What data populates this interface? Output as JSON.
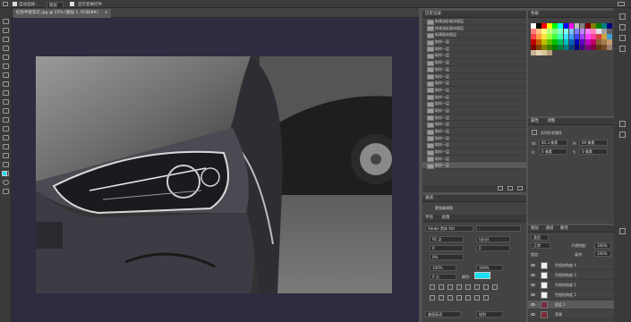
{
  "options_bar": {
    "auto_select_label": "自动选择：",
    "auto_select_value": "图层",
    "show_transform_label": "显示变换控件"
  },
  "document_tab": {
    "title": "红色半瓷车灯.jpg @ 25% (图层 1, RGB/8#)"
  },
  "history_panel": {
    "title": "历史记录",
    "items": [
      "新建油彩填充图层",
      "修改油彩填充图层",
      "新建填充图层",
      "取样一层",
      "取样一层",
      "取样一层",
      "取样一层",
      "取样一层",
      "取样一层",
      "取样一层",
      "取样一层",
      "取样一层",
      "取样一层",
      "取样一层",
      "取样一层",
      "取样一层",
      "取样一层",
      "取样一层",
      "取样一层",
      "取样一层",
      "取样一层",
      "取样一层"
    ]
  },
  "swatches_panel": {
    "title": "色板",
    "colors": [
      "#ffffff",
      "#000000",
      "#ff0000",
      "#ffff00",
      "#00ff00",
      "#00ffff",
      "#0000ff",
      "#ff00ff",
      "#c0c0c0",
      "#808080",
      "#800000",
      "#808000",
      "#008000",
      "#008080",
      "#000080",
      "#ff7f7f",
      "#ffbf7f",
      "#ffff7f",
      "#bfff7f",
      "#7fff7f",
      "#7fffbf",
      "#7fffff",
      "#7fbfff",
      "#7f7fff",
      "#bf7fff",
      "#ff7fff",
      "#ff7fbf",
      "#e0e0e0",
      "#a0a0a0",
      "#606060",
      "#ff4040",
      "#ff9f40",
      "#ffdf40",
      "#9fff40",
      "#40ff40",
      "#40ffb0",
      "#40dfff",
      "#409fff",
      "#4040ff",
      "#9f40ff",
      "#ff40ff",
      "#ff40a0",
      "#d04040",
      "#d0a040",
      "#40a0d0",
      "#c00000",
      "#c06000",
      "#c0c000",
      "#60c000",
      "#00c000",
      "#00c060",
      "#00c0c0",
      "#0060c0",
      "#0000c0",
      "#6000c0",
      "#c000c0",
      "#c00060",
      "#8c6239",
      "#a67c52",
      "#c69c6d",
      "#800000",
      "#804000",
      "#808000",
      "#408000",
      "#008000",
      "#008040",
      "#008080",
      "#004080",
      "#000080",
      "#400080",
      "#800080",
      "#800040",
      "#603913",
      "#754c24",
      "#998675",
      "#c7b299",
      "#e6d3b3",
      "#d9c39a",
      "#b79e7a"
    ]
  },
  "properties_panel": {
    "tab1": "属性",
    "tab2": "调整",
    "subtitle": "实时形状属性",
    "w_label": "W:",
    "w_value": "85.3 像素",
    "h_label": "H:",
    "h_value": "69 像素",
    "x_label": "X:",
    "x_value": "0 像素",
    "y_label": "Y:",
    "y_value": "0 像素"
  },
  "character_panel": {
    "panel1_title": "通道",
    "channel_item": "蒙版编辑图",
    "tab1": "字符",
    "tab2": "段落",
    "font_family": "Adobe 黑体 Std",
    "font_style": "-",
    "font_size": "95 点",
    "leading": "(自动)",
    "tracking": "0",
    "kerning": "0%",
    "scale_v": "100%",
    "scale_h": "100%",
    "baseline": "0 点",
    "color_label": "颜色:",
    "color_value": "#19e0f0",
    "language": "美国英语",
    "antialias": "锐利"
  },
  "layers_panel": {
    "tab1": "图层",
    "tab2": "通道",
    "tab3": "路径",
    "kind_label": "类型",
    "blend_mode": "正常",
    "opacity_label": "不透明度:",
    "opacity_value": "100%",
    "lock_label": "锁定:",
    "fill_label": "填充:",
    "fill_value": "100%",
    "layers": [
      "色相饱和度 4",
      "色相饱和度 3",
      "色相饱和度 2",
      "色相饱和度 1",
      "图层 1",
      "背景"
    ]
  },
  "colors": {
    "canvas_bg": "#2f2b40",
    "foreground": "#19e0f0",
    "background": "#c0247a"
  }
}
